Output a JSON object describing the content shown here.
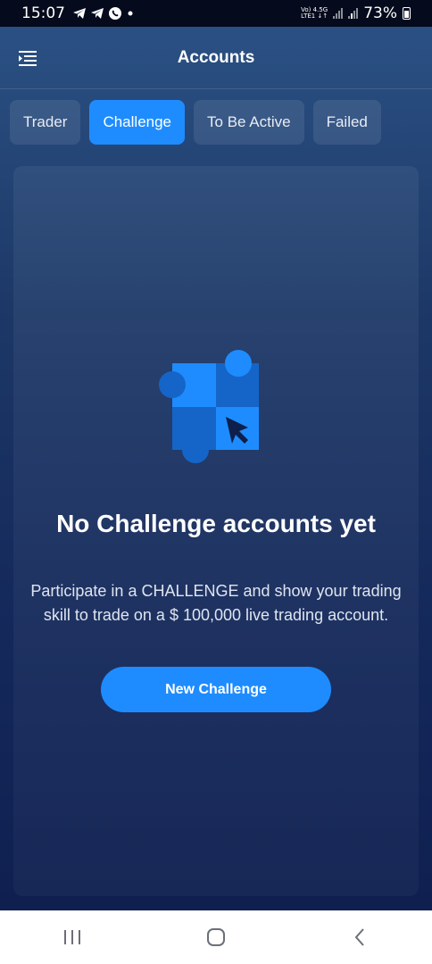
{
  "status_bar": {
    "time": "15:07",
    "network_top": "Vo) 4.5G",
    "network_bottom": "LTE1 ↓↑",
    "battery": "73%"
  },
  "header": {
    "title": "Accounts",
    "menu_icon": "menu-list-icon"
  },
  "tabs": [
    {
      "label": "Trader",
      "active": false
    },
    {
      "label": "Challenge",
      "active": true
    },
    {
      "label": "To Be Active",
      "active": false
    },
    {
      "label": "Failed",
      "active": false
    }
  ],
  "empty_state": {
    "title": "No Challenge accounts yet",
    "description": "Participate in a CHALLENGE and show your trading skill to trade on a $ 100,000 live trading account.",
    "button_label": "New Challenge",
    "illustration_icon": "challenge-cursor-icon"
  },
  "colors": {
    "accent": "#1e8cff",
    "background_top": "#2c5386",
    "background_bottom": "#0f2050"
  },
  "nav_bar": {
    "recent_icon": "recent-apps-icon",
    "home_icon": "home-icon",
    "back_icon": "back-icon"
  }
}
